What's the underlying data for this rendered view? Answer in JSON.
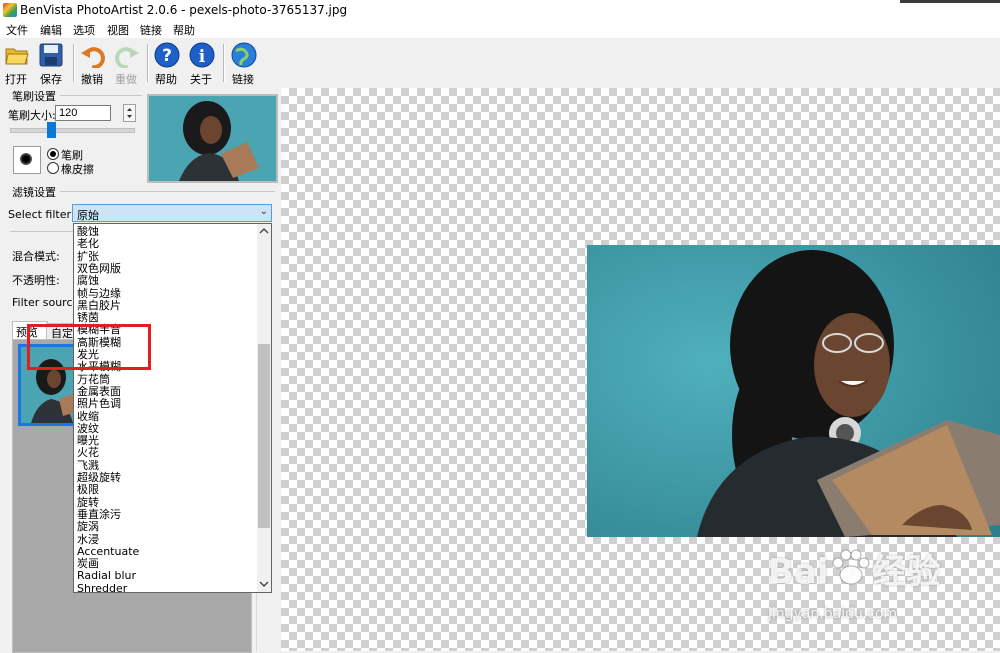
{
  "window": {
    "title": "BenVista PhotoArtist 2.0.6 - pexels-photo-3765137.jpg"
  },
  "menu": [
    "文件",
    "编辑",
    "选项",
    "视图",
    "链接",
    "帮助"
  ],
  "toolbar": {
    "open": "打开",
    "save": "保存",
    "undo": "撤销",
    "redo": "重做",
    "help": "帮助",
    "about": "关于",
    "link": "链接"
  },
  "brush": {
    "section_title": "笔刷设置",
    "size_label": "笔刷大小:",
    "size_value": "120",
    "mode_brush": "笔刷",
    "mode_eraser": "橡皮擦",
    "slider_fraction": 0.3
  },
  "filter": {
    "section_title": "滤镜设置",
    "select_label": "Select filter:",
    "selected": "原始",
    "blend_label": "混合模式:",
    "opacity_label": "不透明性:",
    "source_label": "Filter source:",
    "tab_preview": "预览",
    "tab_custom": "自定",
    "options": [
      "酸蚀",
      "老化",
      "扩张",
      "双色网版",
      "腐蚀",
      "帧与边缘",
      "黑白胶片",
      "锈茵",
      "模糊半音",
      "高斯模糊",
      "发光",
      "水平模糊",
      "万花筒",
      "金属表面",
      "照片色调",
      "收缩",
      "波纹",
      "曝光",
      "火花",
      "飞溅",
      "超级旋转",
      "极限",
      "旋转",
      "垂直涂污",
      "旋涡",
      "水浸",
      "Accentuate",
      "炭画",
      "Radial blur",
      "Shredder"
    ]
  },
  "watermark": {
    "brand": "Bai",
    "brand_cn": "经验",
    "url": "jingyan.baidu.com"
  },
  "colors": {
    "accent": "#1e73e8",
    "highlight": "#e02020",
    "photo_bg": "#48a0ad"
  }
}
